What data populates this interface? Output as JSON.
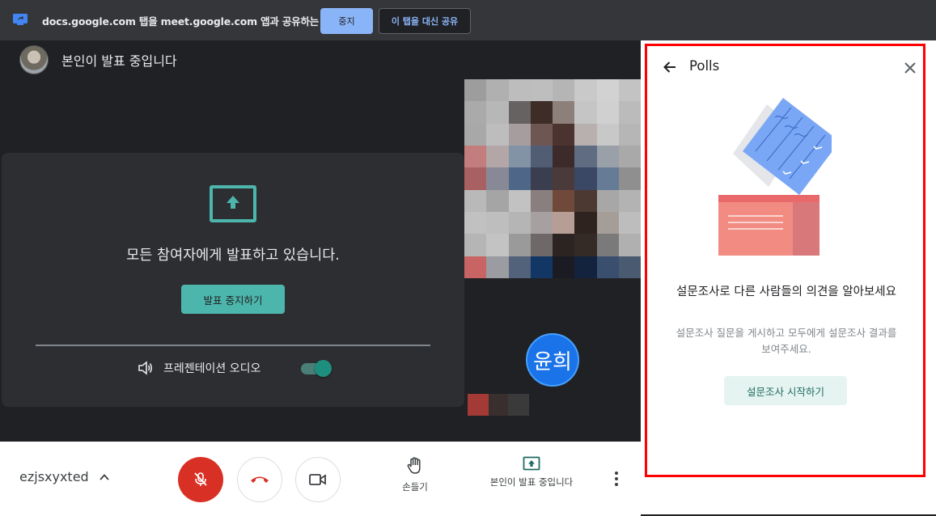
{
  "share_bar": {
    "message": "docs.google.com 탭을 meet.google.com 앱과 공유하는 중",
    "stop_label": "중지",
    "share_instead_label": "이 탭을 대신 공유"
  },
  "stage": {
    "presenter_label": "본인이 발표 중입니다",
    "card_title": "모든 참여자에게 발표하고 있습니다.",
    "stop_presenting_label": "발표 중지하기",
    "audio_label": "프레젠테이션 오디오",
    "audio_enabled": true
  },
  "participants": {
    "avatar_text": "윤희"
  },
  "controls": {
    "meeting_code": "ezjsxyxted",
    "raise_hand_label": "손들기",
    "presenting_label": "본인이 발표 중입니다",
    "mic_state": "muted"
  },
  "panel": {
    "title": "Polls",
    "headline": "설문조사로 다른 사람들의 의견을 알아보세요",
    "subtext": "설문조사 질문을 게시하고 모두에게 설문조사 결과를 보여주세요.",
    "start_label": "설문조사 시작하기"
  },
  "colors": {
    "accent_teal": "#4db6ac",
    "mic_red": "#d93025",
    "highlight_border": "#ff0000",
    "link_blue": "#8ab4f8"
  },
  "icons": {
    "share": "screen-share-icon",
    "back": "arrow-back-icon",
    "close": "close-icon",
    "mic": "mic-off-icon",
    "hangup": "call-end-icon",
    "camera": "videocam-icon",
    "hand": "hand-icon",
    "present": "present-to-all-icon",
    "more": "more-vert-icon"
  }
}
